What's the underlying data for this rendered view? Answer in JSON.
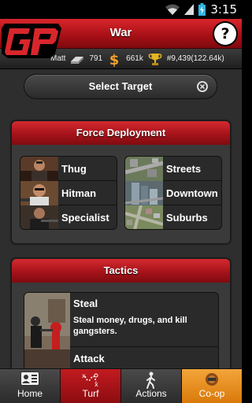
{
  "status": {
    "time": "3:15"
  },
  "header": {
    "title": "War",
    "help_label": "?"
  },
  "stats": {
    "name": "Matt",
    "silver": "791",
    "cash": "661k",
    "trophy": "#9,439(122.64k)"
  },
  "select_target": {
    "label": "Select Target"
  },
  "force_deployment": {
    "title": "Force Deployment",
    "units": [
      {
        "label": "Thug"
      },
      {
        "label": "Hitman"
      },
      {
        "label": "Specialist"
      }
    ],
    "areas": [
      {
        "label": "Streets"
      },
      {
        "label": "Downtown"
      },
      {
        "label": "Suburbs"
      }
    ]
  },
  "tactics": {
    "title": "Tactics",
    "items": [
      {
        "title": "Steal",
        "description": "Steal money, drugs, and kill gangsters."
      },
      {
        "title": "Attack"
      }
    ]
  },
  "tabs": [
    {
      "label": "Home"
    },
    {
      "label": "Turf"
    },
    {
      "label": "Actions"
    },
    {
      "label": "Co-op"
    }
  ],
  "colors": {
    "accent_red": "#c21b20",
    "coop_orange": "#e88c1c"
  }
}
